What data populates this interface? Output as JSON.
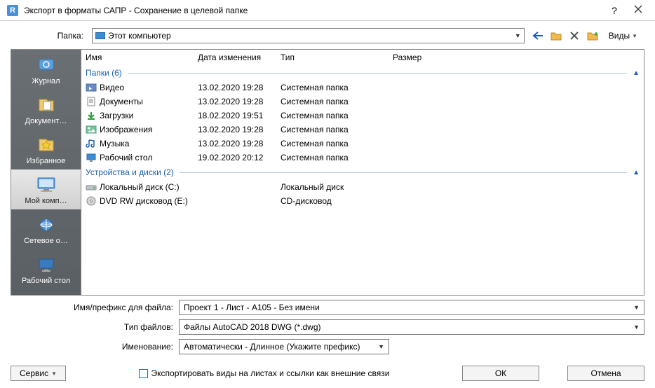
{
  "title": "Экспорт в форматы САПР - Сохранение в целевой папке",
  "help_glyph": "?",
  "folder_label": "Папка:",
  "location": "Этот компьютер",
  "views_label": "Виды",
  "columns": {
    "name": "Имя",
    "date": "Дата изменения",
    "type": "Тип",
    "size": "Размер"
  },
  "groups": {
    "folders": {
      "label": "Папки",
      "count": "(6)"
    },
    "drives": {
      "label": "Устройства и диски",
      "count": "(2)"
    }
  },
  "folders": [
    {
      "name": "Видео",
      "date": "13.02.2020 19:28",
      "type": "Системная папка"
    },
    {
      "name": "Документы",
      "date": "13.02.2020 19:28",
      "type": "Системная папка"
    },
    {
      "name": "Загрузки",
      "date": "18.02.2020 19:51",
      "type": "Системная папка"
    },
    {
      "name": "Изображения",
      "date": "13.02.2020 19:28",
      "type": "Системная папка"
    },
    {
      "name": "Музыка",
      "date": "13.02.2020 19:28",
      "type": "Системная папка"
    },
    {
      "name": "Рабочий стол",
      "date": "19.02.2020 20:12",
      "type": "Системная папка"
    }
  ],
  "drives": [
    {
      "name": "Локальный диск (C:)",
      "date": "",
      "type": "Локальный диск"
    },
    {
      "name": "DVD RW дисковод (E:)",
      "date": "",
      "type": "CD-дисковод"
    }
  ],
  "sidebar": [
    {
      "label": "Журнал",
      "icon": "history"
    },
    {
      "label": "Документ…",
      "icon": "doc"
    },
    {
      "label": "Избранное",
      "icon": "fav"
    },
    {
      "label": "Мой комп…",
      "icon": "pc",
      "selected": true
    },
    {
      "label": "Сетевое о…",
      "icon": "net"
    },
    {
      "label": "Рабочий стол",
      "icon": "desktop"
    }
  ],
  "form": {
    "filename_label": "Имя/префикс для файла:",
    "filename_value": "Проект 1 - Лист - А105 - Без имени",
    "filetype_label": "Тип файлов:",
    "filetype_value": "Файлы AutoCAD 2018 DWG  (*.dwg)",
    "naming_label": "Именование:",
    "naming_value": "Автоматически - Длинное (Укажите префикс)"
  },
  "checkbox_label": "Экспортировать виды на листах и ссылки как внешние связи",
  "service_label": "Сервис",
  "ok_label": "ОК",
  "cancel_label": "Отмена"
}
